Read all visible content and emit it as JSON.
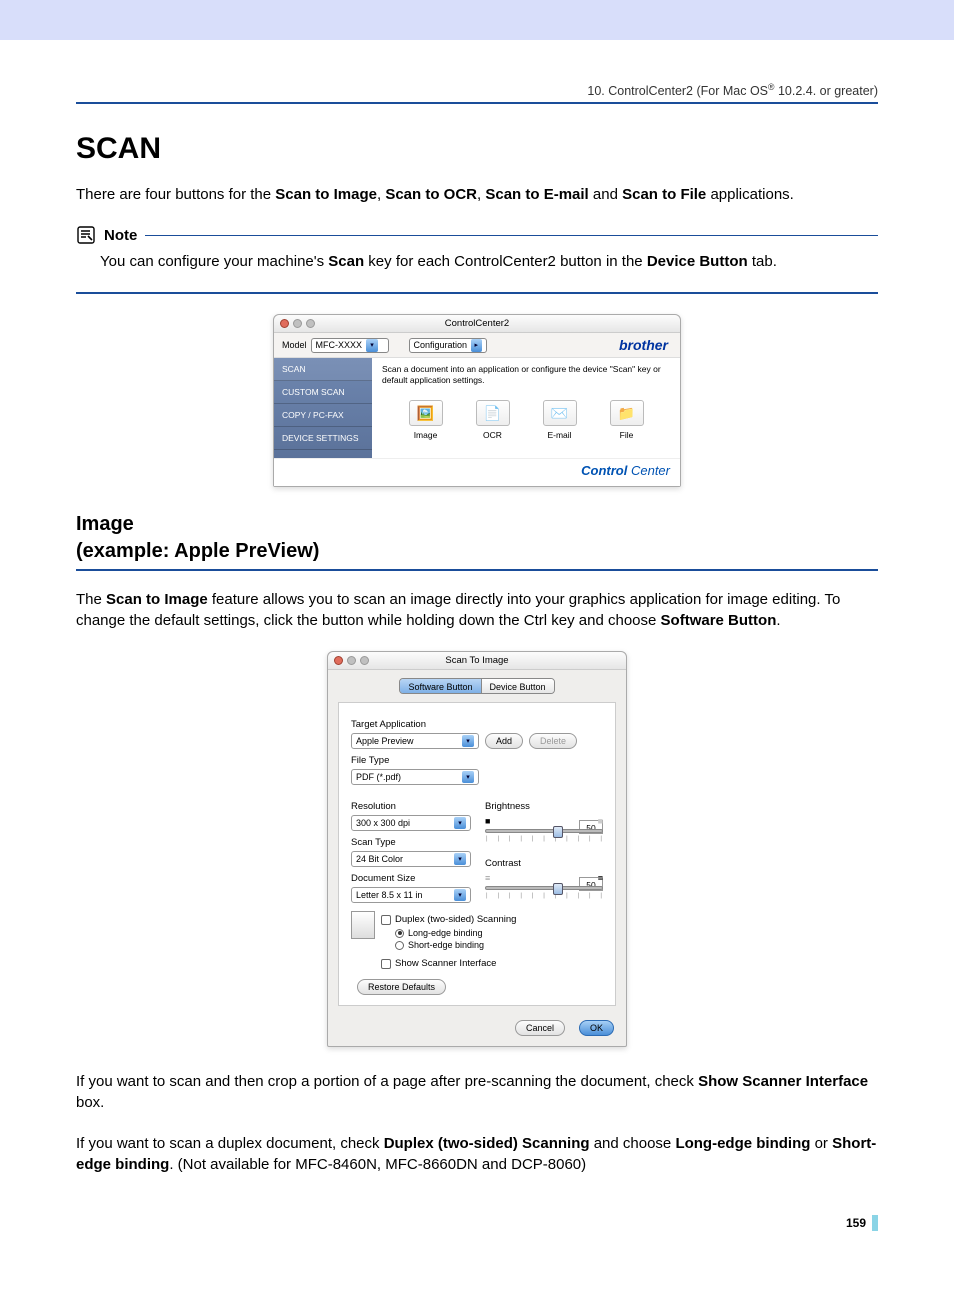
{
  "header": {
    "chapter": "10. ControlCenter2 (For Mac OS",
    "chapter_suffix": " 10.2.4. or greater)",
    "reg": "®"
  },
  "h1": "SCAN",
  "intro": {
    "t1": "There are four buttons for the ",
    "b1": "Scan to Image",
    "c1": ", ",
    "b2": "Scan to OCR",
    "c2": ", ",
    "b3": "Scan to E-mail",
    "c3": " and ",
    "b4": "Scan to File",
    "c4": " applications."
  },
  "note": {
    "label": "Note",
    "t1": "You can configure your machine's ",
    "b1": "Scan",
    "t2": " key for each ControlCenter2 button in the ",
    "b2": "Device Button",
    "t3": " tab."
  },
  "cc2": {
    "title": "ControlCenter2",
    "model_label": "Model",
    "model_value": "MFC-XXXX",
    "config_label": "Configuration",
    "brand": "brother",
    "sidebar": {
      "scan": "SCAN",
      "custom": "CUSTOM SCAN",
      "copy": "COPY / PC-FAX",
      "device": "DEVICE SETTINGS"
    },
    "desc": "Scan a document into an application or configure the device \"Scan\" key or default application settings.",
    "icons": {
      "image": "Image",
      "ocr": "OCR",
      "email": "E-mail",
      "file": "File"
    },
    "footer_b": "Control",
    "footer_l": " Center"
  },
  "subhead": {
    "l1": "Image",
    "l2": " (example: Apple PreView)"
  },
  "para2": {
    "t1": "The ",
    "b1": "Scan to Image",
    "t2": " feature allows you to scan an image directly into your graphics application for image editing. To change the default settings, click the button while holding down the Ctrl key and choose ",
    "b2": "Software Button",
    "t3": "."
  },
  "sti": {
    "title": "Scan To Image",
    "tabs": {
      "sw": "Software Button",
      "dev": "Device Button"
    },
    "target_label": "Target Application",
    "target_value": "Apple Preview",
    "add": "Add",
    "delete": "Delete",
    "filetype_label": "File Type",
    "filetype_value": "PDF (*.pdf)",
    "resolution_label": "Resolution",
    "resolution_value": "300 x 300 dpi",
    "scantype_label": "Scan Type",
    "scantype_value": "24 Bit Color",
    "docsize_label": "Document Size",
    "docsize_value": "Letter  8.5 x 11 in",
    "brightness_label": "Brightness",
    "brightness_value": "50",
    "contrast_label": "Contrast",
    "contrast_value": "50",
    "duplex": "Duplex (two-sided) Scanning",
    "long_edge": "Long-edge binding",
    "short_edge": "Short-edge binding",
    "show_scanner": "Show Scanner Interface",
    "restore": "Restore Defaults",
    "cancel": "Cancel",
    "ok": "OK"
  },
  "para3": {
    "t1": "If you want to scan and then crop a portion of a page after pre-scanning the document, check ",
    "b1": "Show Scanner Interface",
    "t2": " box."
  },
  "para4": {
    "t1": "If you want to scan a duplex document, check ",
    "b1": "Duplex (two-sided) Scanning",
    "t2": " and choose ",
    "b2": "Long-edge binding",
    "t3": " or ",
    "b3": "Short-edge binding",
    "t4": ". (Not available for MFC-8460N, MFC-8660DN and DCP-8060)"
  },
  "page_num": "159"
}
